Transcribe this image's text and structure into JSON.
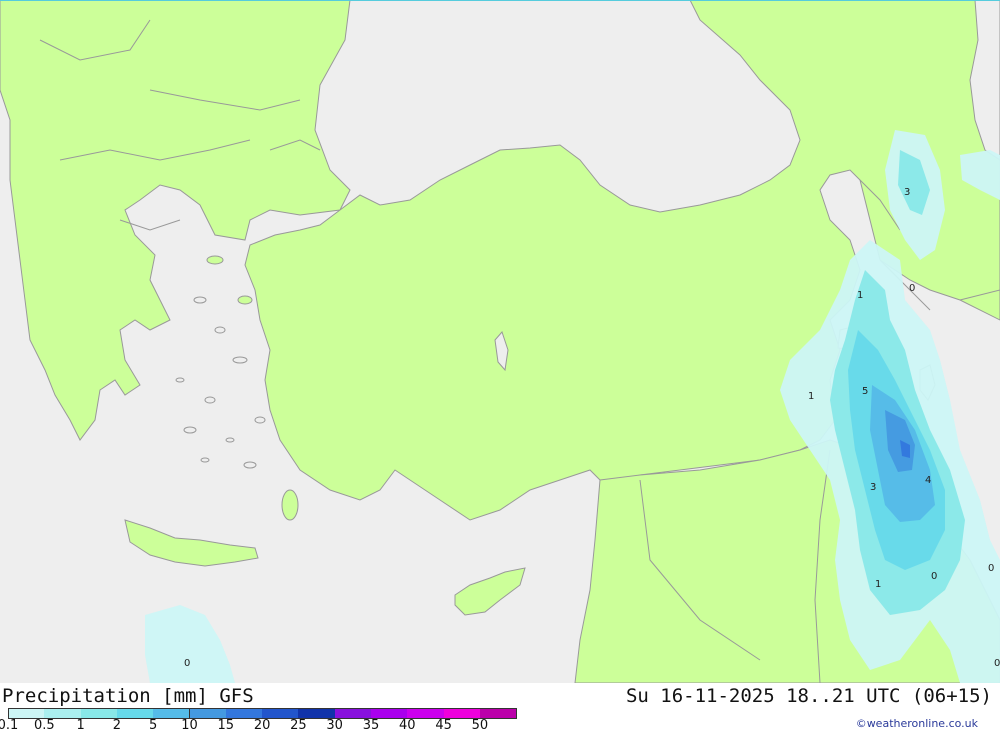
{
  "title": "Precipitation [mm] GFS",
  "datetime": "Su 16-11-2025 18..21 UTC (06+15)",
  "credit": "©weatheronline.co.uk",
  "colors": {
    "land": "#ccff99",
    "sea": "#eeeeee",
    "border": "#999999"
  },
  "legend": {
    "ticks": [
      "0.1",
      "0.5",
      "1",
      "2",
      "5",
      "10",
      "15",
      "20",
      "25",
      "30",
      "35",
      "40",
      "45",
      "50"
    ],
    "colors": [
      "#ccf5f5",
      "#aaefef",
      "#88e8e8",
      "#66d9ea",
      "#55bbe8",
      "#4499e0",
      "#3377dd",
      "#2255cc",
      "#1133aa",
      "#8811dd",
      "#aa00ee",
      "#cc00ee",
      "#ee00dd",
      "#bb00aa"
    ]
  },
  "map_labels": [
    "3",
    "1",
    "0",
    "1",
    "5",
    "4",
    "3",
    "0",
    "1",
    "0",
    "0",
    "0"
  ]
}
